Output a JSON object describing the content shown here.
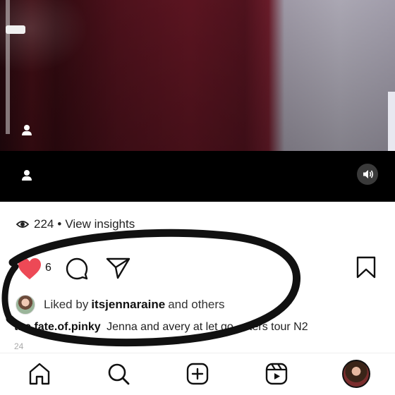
{
  "post": {
    "views_count": "224",
    "views_link": "View insights",
    "separator": "•",
    "likes_count": "6",
    "liked_by_prefix": "Liked by",
    "liked_by_user": "itsjennaraine",
    "liked_by_suffix": "and others",
    "caption_user": "the.fate.of.pinky",
    "caption_text": "Jenna and avery at let go ... ters tour N2",
    "time": "24"
  },
  "icons": {
    "media": [
      "user-tag-icon",
      "user-tag-icon",
      "speaker-icon"
    ],
    "actions": [
      "heart-icon",
      "comment-icon",
      "share-icon",
      "bookmark-icon"
    ],
    "nav": [
      "home-icon",
      "search-icon",
      "new-post-icon",
      "reels-icon",
      "profile-avatar"
    ]
  },
  "colors": {
    "like_red": "#ed4956",
    "annotation": "#111111"
  }
}
